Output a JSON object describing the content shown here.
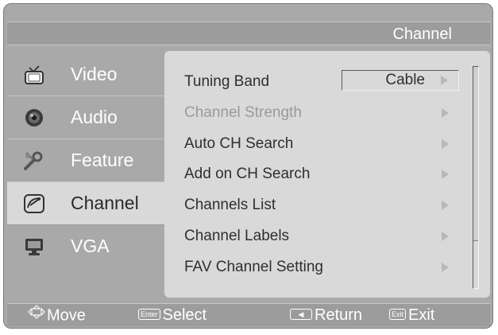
{
  "header": {
    "title": "Channel"
  },
  "menu": {
    "items": [
      {
        "label": "Video",
        "icon": "tv-icon",
        "active": false
      },
      {
        "label": "Audio",
        "icon": "speaker-icon",
        "active": false
      },
      {
        "label": "Feature",
        "icon": "tools-icon",
        "active": false
      },
      {
        "label": "Channel",
        "icon": "satellite-dish-icon",
        "active": true
      },
      {
        "label": "VGA",
        "icon": "monitor-icon",
        "active": false
      }
    ]
  },
  "settings": {
    "rows": [
      {
        "label": "Tuning Band",
        "value": "Cable",
        "enabled": true
      },
      {
        "label": "Channel Strength",
        "enabled": false
      },
      {
        "label": "Auto CH Search",
        "enabled": true
      },
      {
        "label": "Add on CH Search",
        "enabled": true
      },
      {
        "label": "Channels List",
        "enabled": true
      },
      {
        "label": "Channel Labels",
        "enabled": true
      },
      {
        "label": "FAV Channel Setting",
        "enabled": true
      }
    ]
  },
  "footer": {
    "move_label": "Move",
    "enter_key": "Enter",
    "select_label": "Select",
    "return_label": "Return",
    "exit_key": "Exit",
    "exit_label": "Exit"
  },
  "colors": {
    "panel": "#d9d9d9",
    "frame": "#a9a9a9",
    "text_active": "#2f2f2f",
    "text_inactive": "#ffffff"
  }
}
